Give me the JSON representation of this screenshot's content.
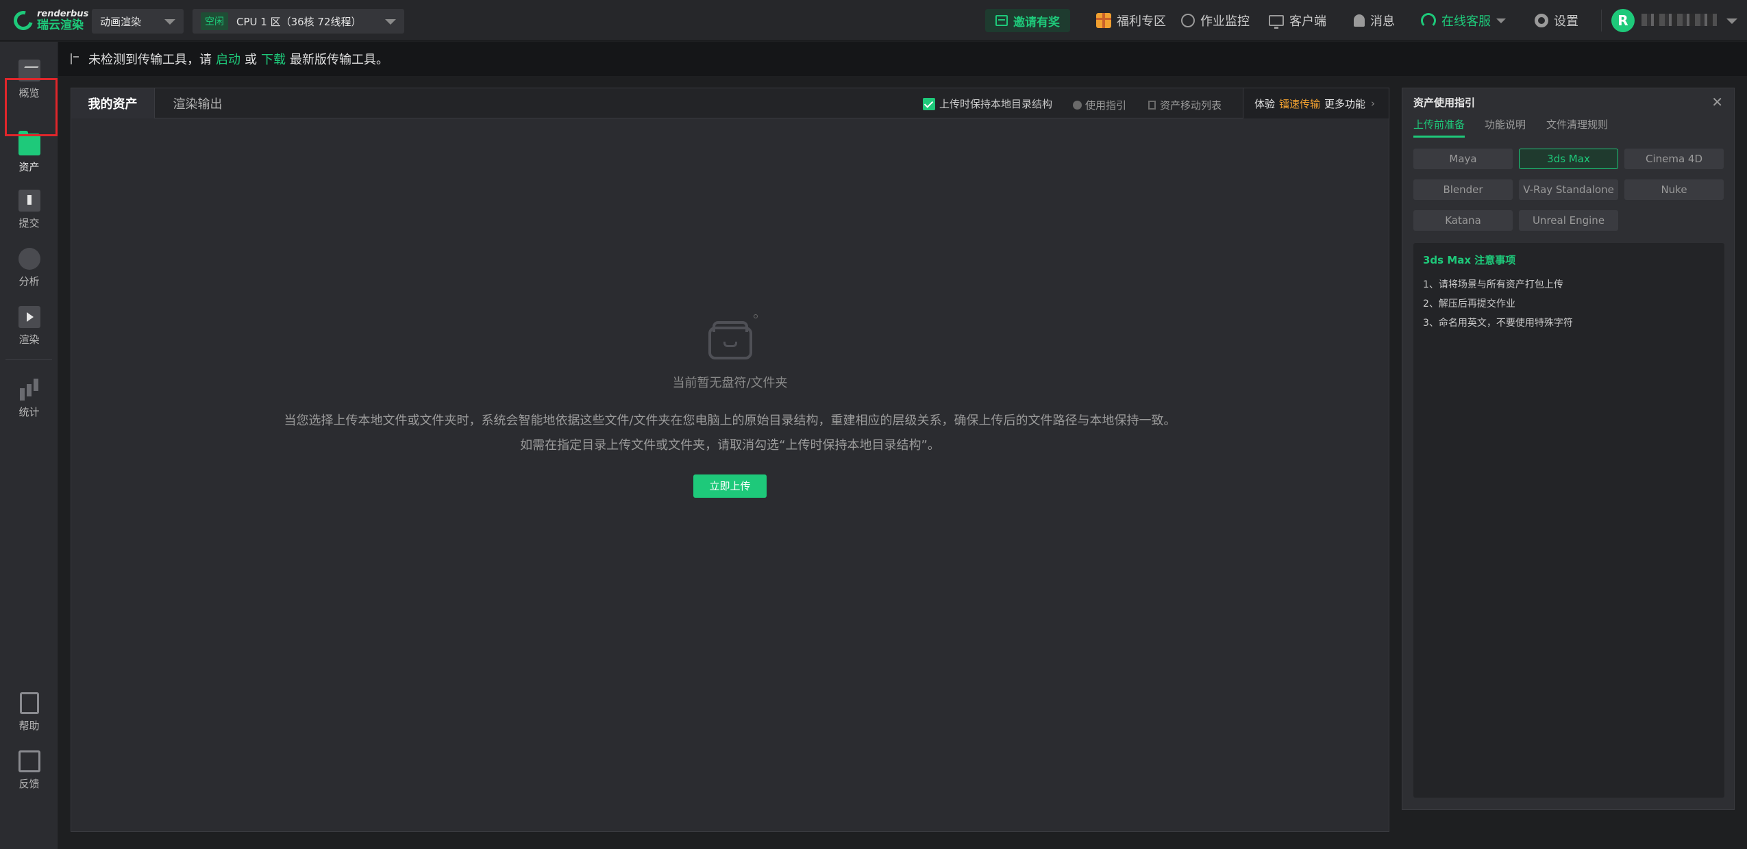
{
  "topbar": {
    "logo_en": "renderbus",
    "logo_cn": "瑞云渲染",
    "mode_select": "动画渲染",
    "status_badge": "空闲",
    "zone_select": "CPU 1 区（36核 72线程）",
    "invite_label": "邀请有奖",
    "welfare_label": "福利专区",
    "monitor_label": "作业监控",
    "client_label": "客户端",
    "message_label": "消息",
    "support_label": "在线客服",
    "settings_label": "设置",
    "avatar_initial": "R"
  },
  "sidebar": {
    "items": [
      {
        "label": "概览",
        "icon": "overview-icon"
      },
      {
        "label": "资产",
        "icon": "folder-icon"
      },
      {
        "label": "提交",
        "icon": "upload-icon"
      },
      {
        "label": "分析",
        "icon": "analysis-icon"
      },
      {
        "label": "渲染",
        "icon": "render-icon"
      },
      {
        "label": "统计",
        "icon": "stats-icon"
      },
      {
        "label": "帮助",
        "icon": "help-doc-icon"
      },
      {
        "label": "反馈",
        "icon": "feedback-icon"
      }
    ],
    "active": "资产"
  },
  "notice": {
    "prefix": "未检测到传输工具，请",
    "start_link": "启动",
    "or": "或",
    "download_link": "下载",
    "suffix": "最新版传输工具。"
  },
  "main": {
    "tabs": [
      {
        "label": "我的资产"
      },
      {
        "label": "渲染输出"
      }
    ],
    "keep_structure_label": "上传时保持本地目录结构",
    "guide_link": "使用指引",
    "move_list_link": "资产移动列表",
    "try_prefix": "体验",
    "try_highlight": "镭速传输",
    "try_suffix": "更多功能",
    "empty_title": "当前暂无盘符/文件夹",
    "empty_desc_1": "当您选择上传本地文件或文件夹时，系统会智能地依据这些文件/文件夹在您电脑上的原始目录结构，重建相应的层级关系，确保上传后的文件路径与本地保持一致。",
    "empty_desc_2": "如需在指定目录上传文件或文件夹，请取消勾选“上传时保持本地目录结构”。",
    "upload_button": "立即上传"
  },
  "guide": {
    "title": "资产使用指引",
    "close": "✕",
    "tabs": [
      {
        "label": "上传前准备"
      },
      {
        "label": "功能说明"
      },
      {
        "label": "文件清理规则"
      }
    ],
    "software": [
      "Maya",
      "3ds Max",
      "Cinema 4D",
      "Blender",
      "V-Ray Standalone",
      "Nuke",
      "Katana",
      "Unreal Engine"
    ],
    "selected_software": "3ds Max",
    "notes_title": "3ds Max 注意事项",
    "notes": [
      "1、请将场景与所有资产打包上传",
      "2、解压后再提交作业",
      "3、命名用英文，不要使用特殊字符"
    ]
  },
  "colors": {
    "accent": "#1ec97a",
    "highlight_orange": "#f0a030",
    "active_outline": "#e0262b"
  }
}
